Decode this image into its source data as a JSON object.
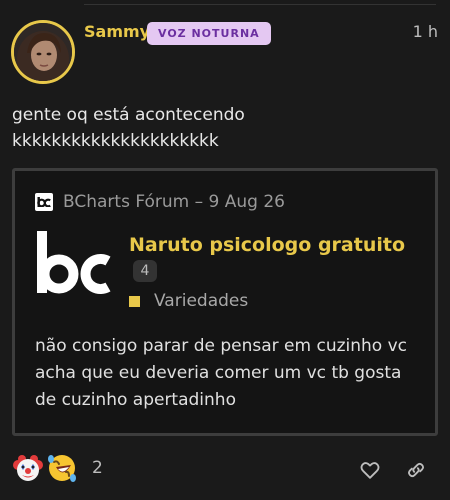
{
  "post": {
    "username": "Sammy",
    "badge": "VOZ NOTURNA",
    "time": "1 h",
    "body_lines": [
      "gente oq está acontecendo",
      "kkkkkkkkkkkkkkkkkkkkk"
    ]
  },
  "onebox": {
    "source": "BCharts Fórum – 9 Aug 26",
    "logo_text": "bc",
    "topic_title": "Naruto psicologo gratuito",
    "reply_count": "4",
    "category": "Variedades",
    "excerpt_lines": [
      "não consigo parar de pensar em cuzinho vc",
      "acha que eu deveria comer um vc tb gosta",
      "de cuzinho apertadinho"
    ]
  },
  "reactions": {
    "emojis": [
      "clown-face",
      "rolling-on-floor-laughing"
    ],
    "count": "2"
  },
  "actions": {
    "like": "heart-icon",
    "share": "link-icon"
  },
  "colors": {
    "background": "#1a1a1a",
    "accent": "#e8c84a",
    "badge_bg": "#e4c8f2",
    "badge_text": "#6b2fa0"
  }
}
